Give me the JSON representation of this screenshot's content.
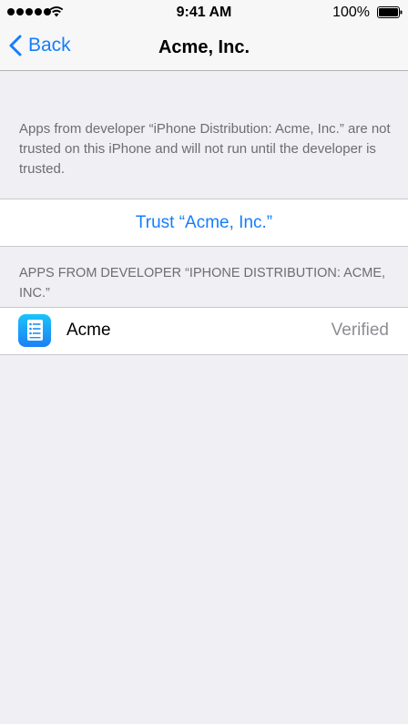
{
  "status_bar": {
    "time": "9:41 AM",
    "battery": "100%",
    "signal_icon": "signal-dots-icon",
    "wifi_icon": "wifi-icon",
    "battery_icon": "battery-icon"
  },
  "nav": {
    "back_label": "Back",
    "back_icon": "chevron-left-icon",
    "title": "Acme, Inc."
  },
  "info": {
    "text": "Apps from developer “iPhone Distribution: Acme, Inc.” are not trusted on this iPhone and will not run until the developer is trusted."
  },
  "trust_button": {
    "label": "Trust “Acme, Inc.”"
  },
  "apps_section": {
    "header": "APPS FROM DEVELOPER “IPHONE DISTRIBUTION: ACME, INC.”",
    "apps": [
      {
        "name": "Acme",
        "status": "Verified",
        "icon": "app-icon"
      }
    ]
  },
  "colors": {
    "accent": "#157efb",
    "background": "#efeff4",
    "secondary_text": "#6d6d72",
    "status_text": "#8e8e93"
  }
}
